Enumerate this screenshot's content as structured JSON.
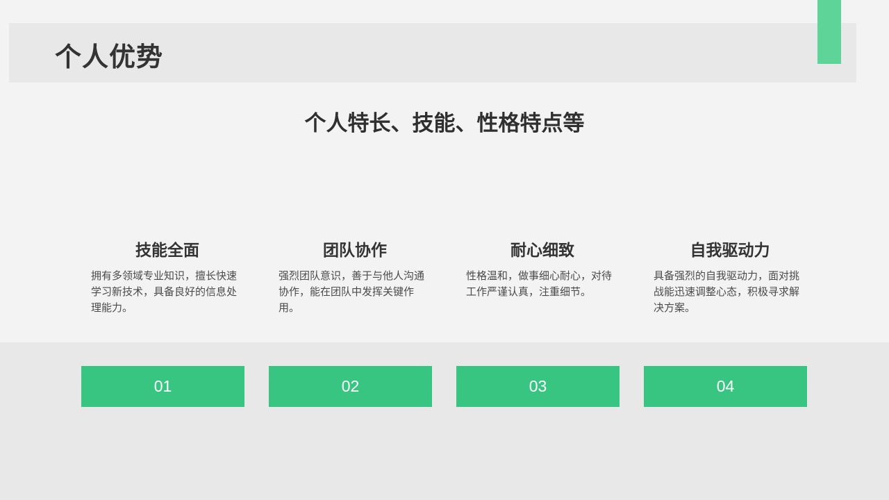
{
  "header": {
    "title": "个人优势"
  },
  "subtitle": "个人特长、技能、性格特点等",
  "features": [
    {
      "title": "技能全面",
      "description": "拥有多领域专业知识，擅长快速学习新技术，具备良好的信息处理能力。",
      "number": "01"
    },
    {
      "title": "团队协作",
      "description": "强烈团队意识，善于与他人沟通协作，能在团队中发挥关键作用。",
      "number": "02"
    },
    {
      "title": "耐心细致",
      "description": "性格温和，做事细心耐心，对待工作严谨认真，注重细节。",
      "number": "03"
    },
    {
      "title": "自我驱动力",
      "description": "具备强烈的自我驱动力，面对挑战能迅速调整心态，积极寻求解决方案。",
      "number": "04"
    }
  ],
  "colors": {
    "accent": "#38c581",
    "accent_light": "#5fd498",
    "background": "#f3f3f3",
    "band": "#e8e8e8",
    "text": "#333333"
  }
}
